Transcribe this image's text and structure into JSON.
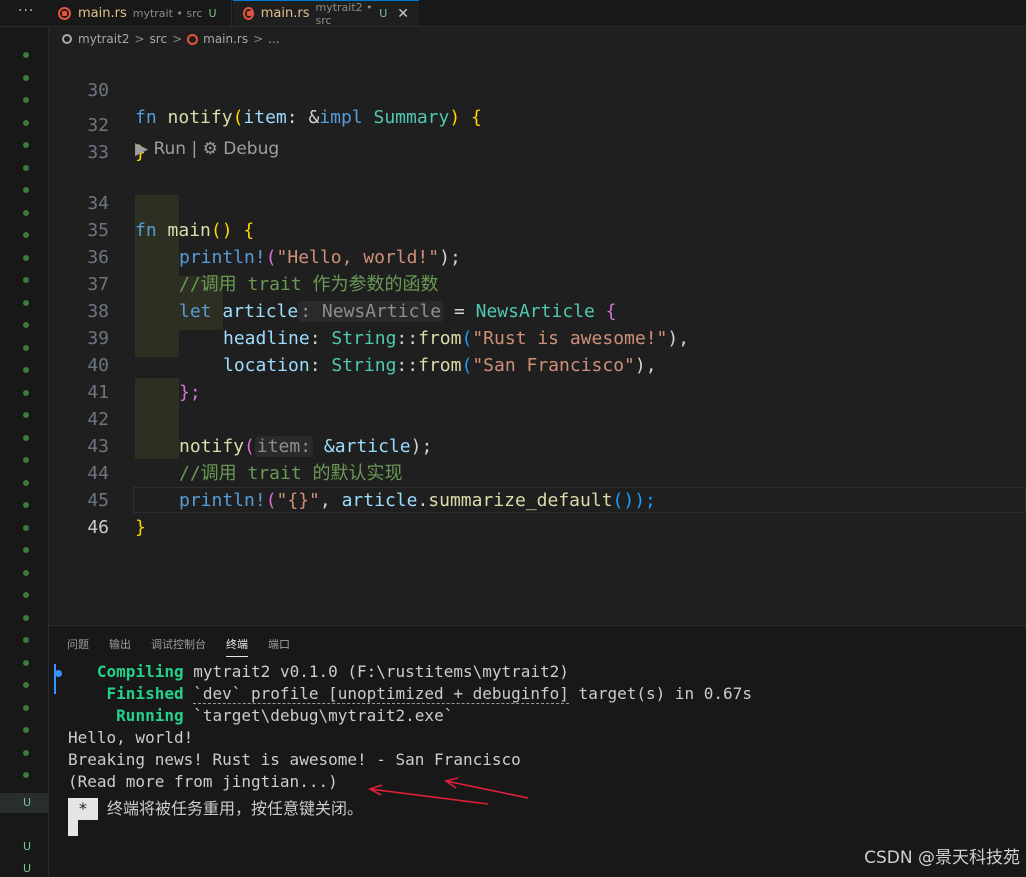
{
  "tabs": [
    {
      "name": "main.rs",
      "desc": "mytrait • src",
      "status": "U"
    },
    {
      "name": "main.rs",
      "desc": "mytrait2 • src",
      "status": "U",
      "close": "✕"
    }
  ],
  "more": "···",
  "breadcrumb": {
    "project": "mytrait2",
    "folder": "src",
    "file": "main.rs",
    "tail": "...",
    "sep": ">"
  },
  "codelens": "▶ Run | ⚙ Debug",
  "line_numbers": [
    "30",
    "32",
    "33",
    "34",
    "35",
    "36",
    "37",
    "38",
    "39",
    "40",
    "41",
    "42",
    "43",
    "44",
    "45",
    "46"
  ],
  "code": {
    "l30": {
      "kw": "fn",
      "name": "notify",
      "p1": "(",
      "param": "item",
      "colon": ":",
      "amp": " &",
      "impl": "impl",
      "ty": " Summary",
      "p2": ")",
      "brace": " {"
    },
    "l32": "}",
    "l35": {
      "mac": "println!",
      "o": "(",
      "s": "\"Hello, world!\"",
      "c": ");"
    },
    "l36": "//调用 trait 作为参数的函数",
    "l37": {
      "kw": "let",
      "var": " article",
      "hint": ": NewsArticle",
      "eq": " = ",
      "ty": "NewsArticle",
      "brace": " {"
    },
    "l38": {
      "field": "headline",
      "colon": ": ",
      "ty": "String",
      "sep": "::",
      "fn": "from",
      "o": "(",
      "s": "\"Rust is awesome!\"",
      "c": "),"
    },
    "l39": {
      "field": "location",
      "colon": ": ",
      "ty": "String",
      "sep": "::",
      "fn": "from",
      "o": "(",
      "s": "\"San Francisco\"",
      "c": "),"
    },
    "l40": "};",
    "l42": {
      "fn": "notify",
      "o": "(",
      "hint": "item:",
      "arg": " &article",
      "c": ");"
    },
    "l43": "//调用 trait 的默认实现",
    "l44": {
      "mac": "println!",
      "o": "(",
      "s": "\"{}\"",
      "comma": ", ",
      "var": "article",
      "dot": ".",
      "fn": "summarize_default",
      "c": "());"
    },
    "l45": "}"
  },
  "panel_tabs": [
    "问题",
    "输出",
    "调试控制台",
    "终端",
    "端口"
  ],
  "terminal": {
    "compiling_label": "Compiling",
    "compiling_text": " mytrait2 v0.1.0 (F:\\rustitems\\mytrait2)",
    "finished_label": "Finished",
    "finished_pre": " ",
    "finished_profile": "`dev` profile [unoptimized + debuginfo]",
    "finished_post": " target(s) in 0.67s",
    "running_label": "Running",
    "running_text": " `target\\debug\\mytrait2.exe`",
    "out1": "Hello, world!",
    "out2": "Breaking news! Rust is awesome! - San Francisco",
    "out3": "(Read more from jingtian...)",
    "star": "*",
    "reuse": "终端将被任务重用，按任意键关闭。"
  },
  "gutter_status": [
    "U",
    "U",
    "U"
  ],
  "watermark": "CSDN @景天科技苑",
  "colors": {
    "accent": "#0078d4",
    "modified": "#73c991",
    "rust": "#e5533d",
    "arrow": "#e0203a"
  }
}
